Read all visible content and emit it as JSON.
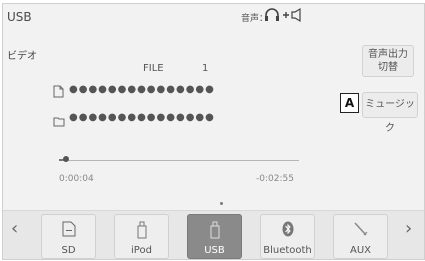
{
  "header": {
    "title": "USB",
    "audio_label": "音声：",
    "audio_output": "ヘッドホン+スピーカー"
  },
  "player": {
    "source_type": "ビデオ",
    "file_label": "FILE",
    "file_number": "1",
    "track_title": "●●●●●●●●●●●●●●●",
    "folder_name": "●●●●●●●●●●●●●●●",
    "progress": 0.03,
    "elapsed": "0:00:04",
    "remaining": "-0:02:55"
  },
  "buttons": {
    "switch_line1": "音声出力",
    "switch_line2": "切替",
    "music": "ミュージック"
  },
  "callout": "A",
  "sources": [
    {
      "label": "SD",
      "icon": "sd-card-icon",
      "active": false
    },
    {
      "label": "iPod",
      "icon": "ipod-icon",
      "active": false
    },
    {
      "label": "USB",
      "icon": "usb-drive-icon",
      "active": true
    },
    {
      "label": "Bluetooth",
      "icon": "bluetooth-icon",
      "active": false
    },
    {
      "label": "AUX",
      "icon": "aux-cable-icon",
      "active": false
    }
  ],
  "nav": {
    "prev": "‹",
    "next": "›"
  }
}
